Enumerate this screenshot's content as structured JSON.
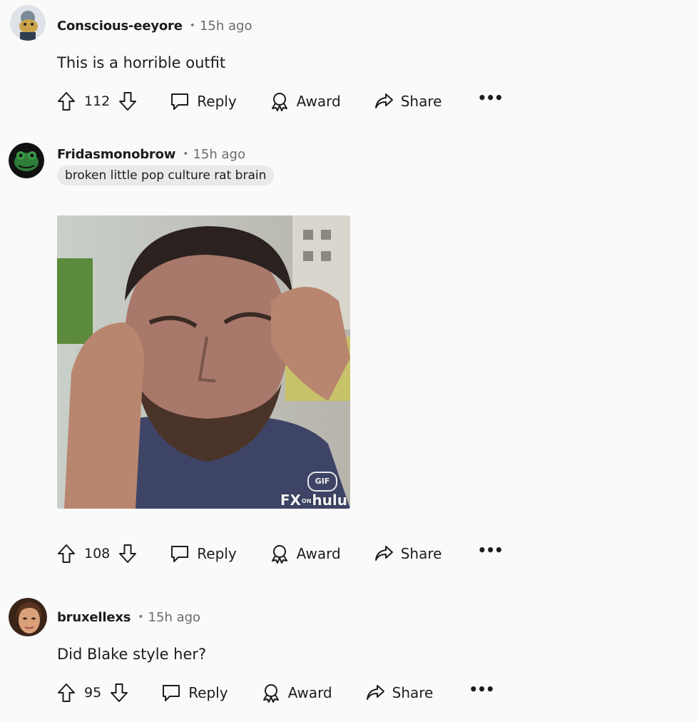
{
  "comments": [
    {
      "username": "Conscious-eeyore",
      "separator": "•",
      "time": "15h ago",
      "body": "This is a horrible outfit",
      "votes": "112",
      "avatar_icon": "eeyore-avatar-icon"
    },
    {
      "username": "Fridasmonobrow",
      "separator": "•",
      "time": "15h ago",
      "flair": "broken little pop culture rat brain",
      "gif": {
        "badge": "GIF",
        "watermark_fx": "FX",
        "watermark_on": "ON",
        "watermark_hulu": "hulu"
      },
      "votes": "108",
      "avatar_icon": "frog-avatar-icon"
    },
    {
      "username": "bruxellexs",
      "separator": "•",
      "time": "15h ago",
      "body": "Did Blake style her?",
      "votes": "95",
      "avatar_icon": "photo-avatar-icon"
    }
  ],
  "actions": {
    "reply": "Reply",
    "award": "Award",
    "share": "Share",
    "more": "•••"
  }
}
